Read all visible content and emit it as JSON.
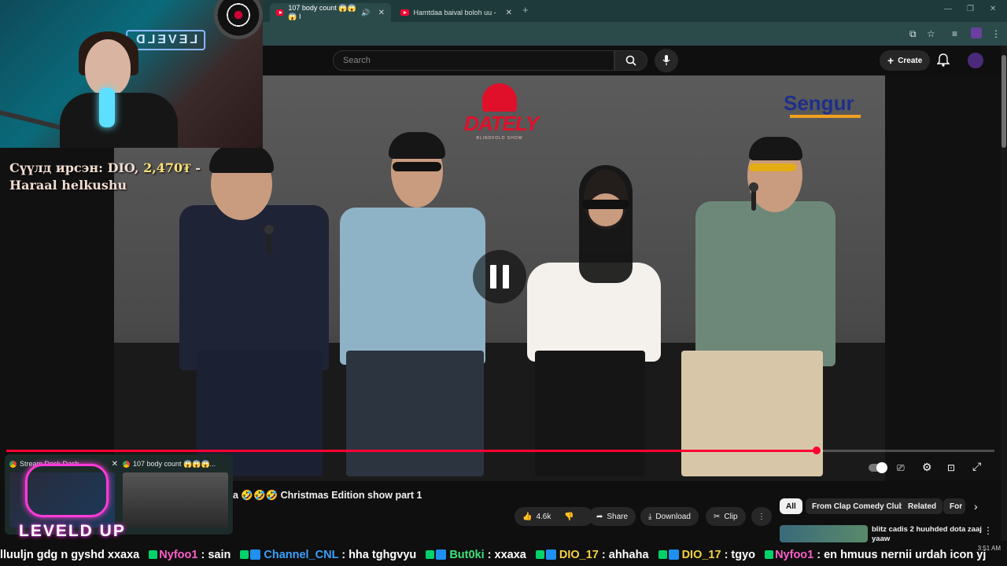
{
  "browser": {
    "tabs": [
      {
        "label": "107 body count 😱😱😱 I",
        "active": true
      },
      {
        "label": "Hamtdaa baival boloh uu - You",
        "active": false
      }
    ],
    "new_tab": "+",
    "window_controls": [
      "—",
      "❐",
      "✕"
    ]
  },
  "youtube": {
    "search_placeholder": "Search",
    "create_label": "Create",
    "video_title": "a 🤣🤣🤣 Christmas Edition show part 1",
    "progress": 0.82,
    "actions": {
      "likes": "4.6k",
      "share": "Share",
      "download": "Download",
      "clip": "Clip",
      "more": "⋮"
    },
    "chips": [
      "All",
      "From Clap Comedy Club",
      "Related",
      "For"
    ],
    "recommendation": {
      "title": "blitz cadis 2 huuhded dota zaaj yaaw"
    },
    "overlay_logos": {
      "dately": "DATELY",
      "dately_sub": "BLINDFOLD SHOW",
      "sponsor": "Sengur"
    }
  },
  "stream_overlay": {
    "webcam_sign": "LEVELD",
    "donation_prefix": "Сүүлд ирсэн: DIO, ",
    "donation_amount": "2,470₮",
    "donation_suffix": " - Haraal helkushu",
    "brand": "LEVELD UP"
  },
  "taskbar_preview": [
    {
      "title": "Stream Deck Dash"
    },
    {
      "title": "107 body count 😱😱😱..."
    }
  ],
  "chat": [
    {
      "user": "",
      "text": "lluuljn gdg n gyshd xxaxa",
      "color": "white"
    },
    {
      "user": "Nyfoo1",
      "text": ": sain",
      "color": "pink"
    },
    {
      "user": "Channel_CNL",
      "text": ": hha tghgvyu",
      "color": "blue"
    },
    {
      "user": "But0ki",
      "text": ": xxaxa",
      "color": "green"
    },
    {
      "user": "DIO_17",
      "text": ": ahhaha",
      "color": "yellow"
    },
    {
      "user": "DIO_17",
      "text": ": tgyo",
      "color": "yellow"
    },
    {
      "user": "Nyfoo1",
      "text": ": en hmuus nernii urdah icon yj",
      "color": "pink"
    }
  ],
  "clock": "3:51 AM",
  "colors": {
    "accent": "#ff0033",
    "tabbar": "#1f3a3a",
    "chat_green_badge": "#00d26a"
  }
}
